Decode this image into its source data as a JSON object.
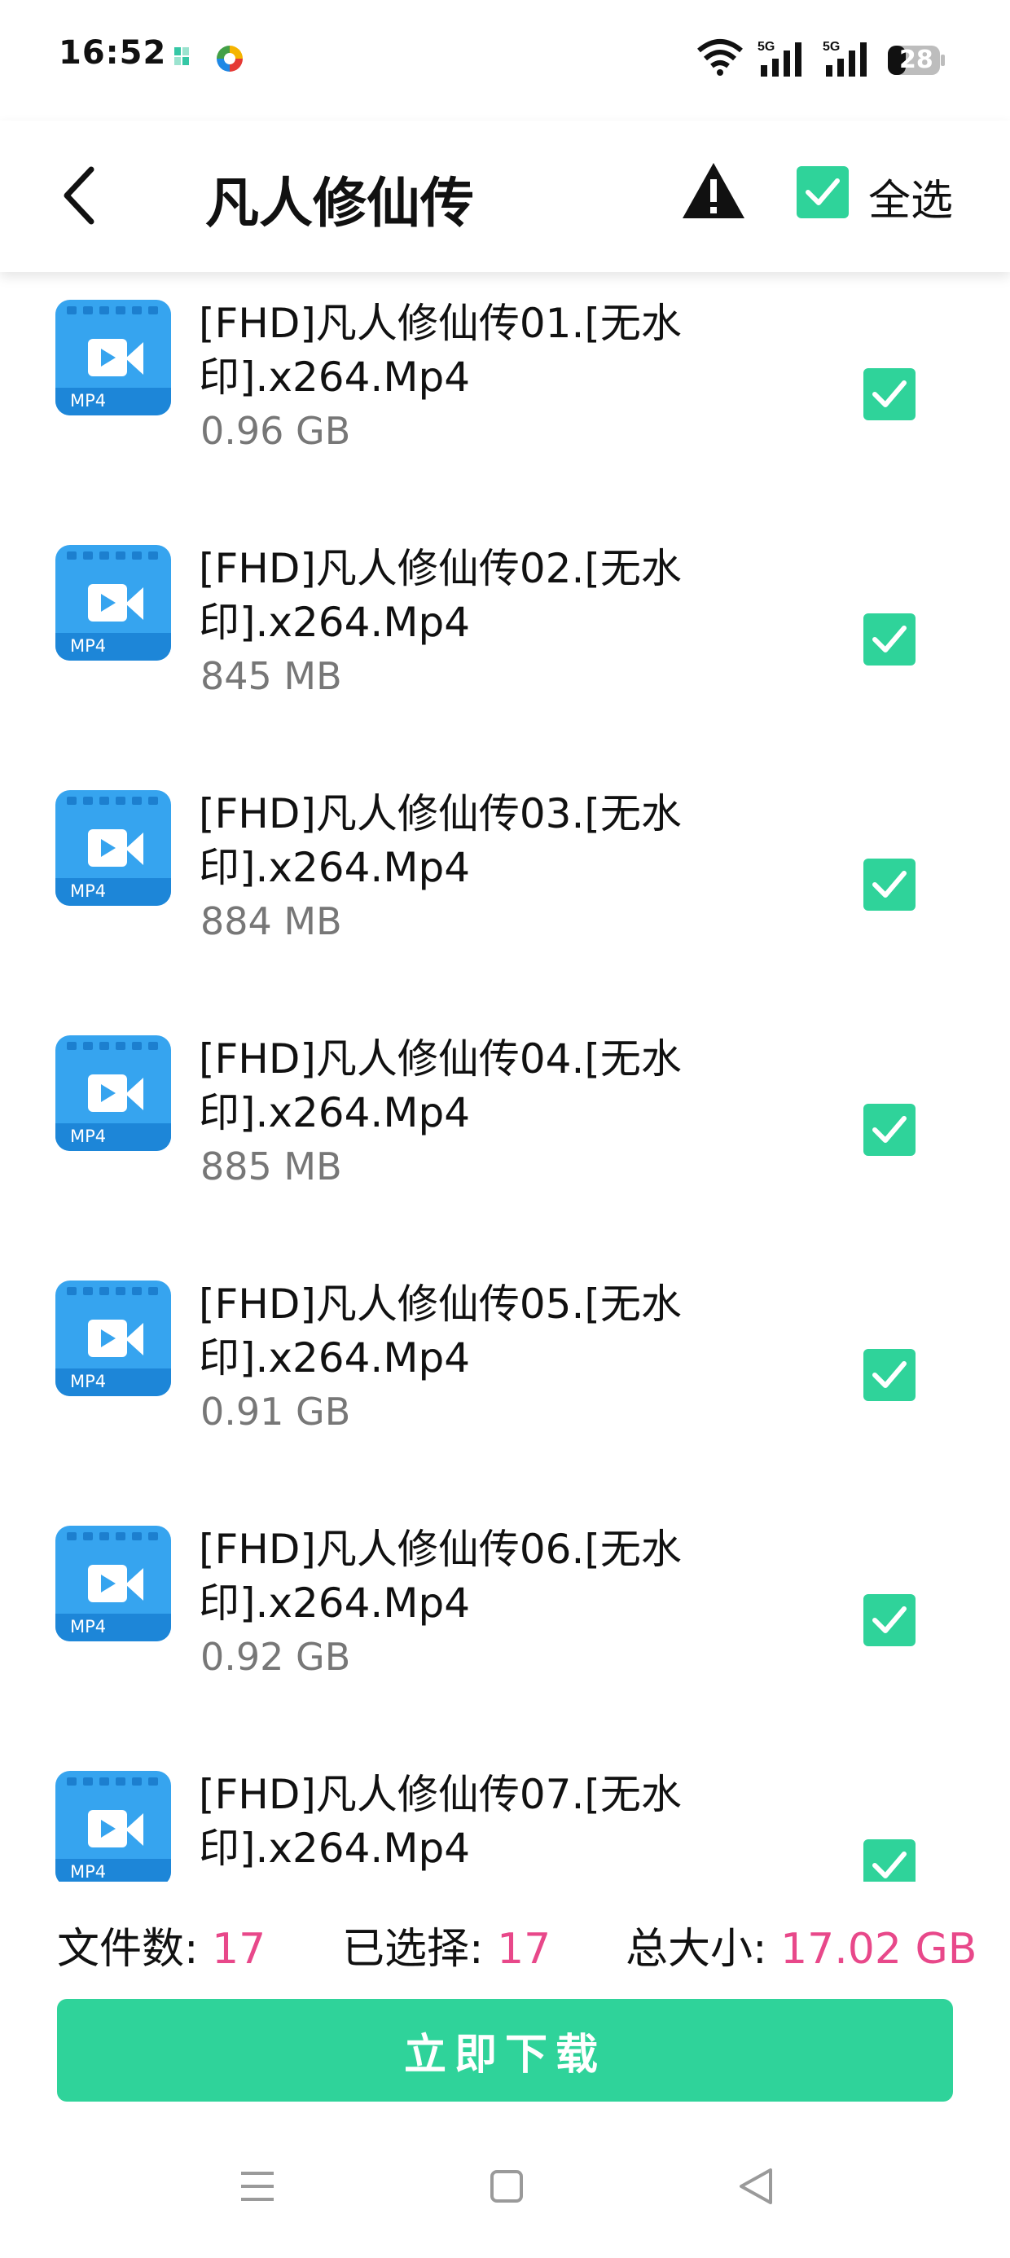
{
  "status_bar": {
    "time": "16:52",
    "network_1": "5G",
    "network_2": "5G",
    "battery": "28"
  },
  "header": {
    "title": "凡人修仙传",
    "select_all_label": "全选",
    "select_all_checked": true
  },
  "files": [
    {
      "name": "[FHD]凡人修仙传01.[无水印].x264.Mp4",
      "size": "0.96 GB",
      "badge": "MP4",
      "checked": true
    },
    {
      "name": "[FHD]凡人修仙传02.[无水印].x264.Mp4",
      "size": "845 MB",
      "badge": "MP4",
      "checked": true
    },
    {
      "name": "[FHD]凡人修仙传03.[无水印].x264.Mp4",
      "size": "884 MB",
      "badge": "MP4",
      "checked": true
    },
    {
      "name": "[FHD]凡人修仙传04.[无水印].x264.Mp4",
      "size": "885 MB",
      "badge": "MP4",
      "checked": true
    },
    {
      "name": "[FHD]凡人修仙传05.[无水印].x264.Mp4",
      "size": "0.91 GB",
      "badge": "MP4",
      "checked": true
    },
    {
      "name": "[FHD]凡人修仙传06.[无水印].x264.Mp4",
      "size": "0.92 GB",
      "badge": "MP4",
      "checked": true
    },
    {
      "name": "[FHD]凡人修仙传07.[无水印].x264.Mp4",
      "size": "",
      "badge": "MP4",
      "checked": true
    }
  ],
  "summary": {
    "files_label": "文件数: ",
    "files_value": "17",
    "selected_label": "已选择: ",
    "selected_value": "17",
    "total_label": "总大小: ",
    "total_value": "17.02 GB"
  },
  "download_button": "立即下载",
  "colors": {
    "accent": "#2fd39a",
    "highlight": "#e8488a",
    "video_icon": "#36a4ef"
  },
  "icons": {
    "back": "chevron-left-icon",
    "warning": "warning-icon",
    "file": "video-file-icon",
    "checkbox": "checkbox-checked-icon",
    "nav": [
      "menu-icon",
      "home-icon",
      "back-triangle-icon"
    ]
  }
}
